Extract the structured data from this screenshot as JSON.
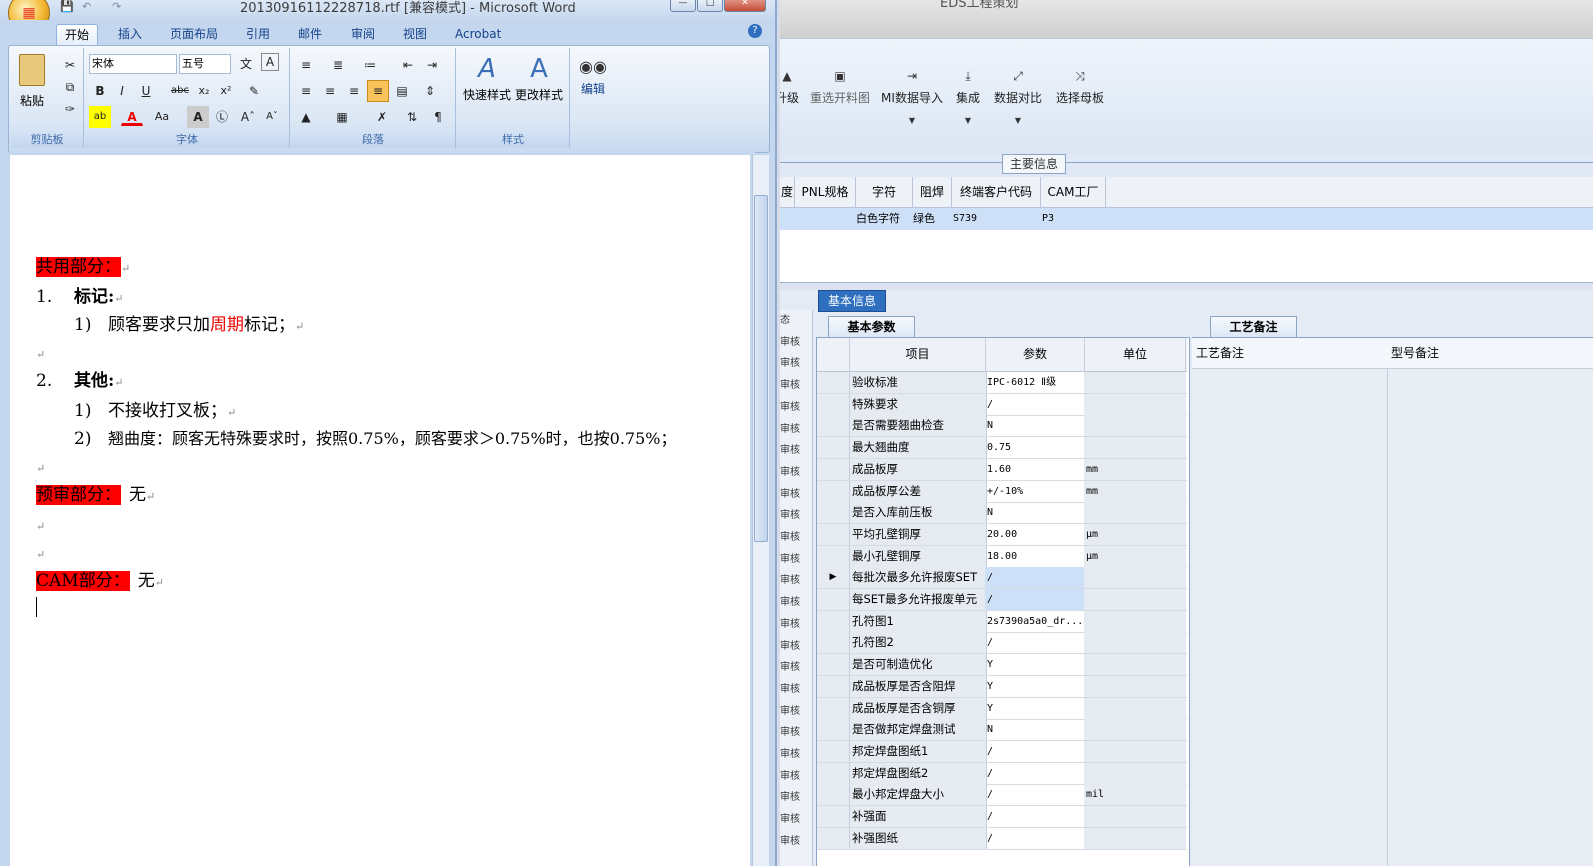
{
  "erp": {
    "title": "EDS工程策划",
    "toolbar": [
      {
        "label": "升级",
        "icon": "upgrade-icon",
        "glyph": "▲",
        "dd": false
      },
      {
        "label": "重选开料图",
        "icon": "image-icon",
        "glyph": "▣",
        "dd": false
      },
      {
        "label": "MI数据导入",
        "icon": "import-icon",
        "glyph": "⇥",
        "dd": true
      },
      {
        "label": "集成",
        "icon": "integrate-icon",
        "glyph": "⤓",
        "dd": true
      },
      {
        "label": "数据对比",
        "icon": "compare-icon",
        "glyph": "⤢",
        "dd": true
      },
      {
        "label": "选择母板",
        "icon": "shuffle-icon",
        "glyph": "⤨",
        "dd": false
      }
    ],
    "main_info_label": "主要信息",
    "grid_columns": [
      "度",
      "PNL规格",
      "字符",
      "阻焊",
      "终端客户代码",
      "CAM工厂"
    ],
    "grid_row": [
      "",
      "",
      "白色字符",
      "绿色",
      "S739",
      "P3"
    ],
    "basic_info_tab": "基本信息",
    "params_tab": "基本参数",
    "param_columns": [
      "项目",
      "参数",
      "单位"
    ],
    "params": [
      {
        "name": "验收标准",
        "value": "IPC-6012 Ⅱ级",
        "unit": ""
      },
      {
        "name": "特殊要求",
        "value": "/",
        "unit": ""
      },
      {
        "name": "是否需要翘曲检查",
        "value": "N",
        "unit": ""
      },
      {
        "name": "最大翘曲度",
        "value": "0.75",
        "unit": ""
      },
      {
        "name": "成品板厚",
        "value": "1.60",
        "unit": "mm"
      },
      {
        "name": "成品板厚公差",
        "value": "+/-10%",
        "unit": "mm"
      },
      {
        "name": "是否入库前压板",
        "value": "N",
        "unit": ""
      },
      {
        "name": "平均孔壁铜厚",
        "value": "20.00",
        "unit": "μm"
      },
      {
        "name": "最小孔壁铜厚",
        "value": "18.00",
        "unit": "μm"
      },
      {
        "name": "每批次最多允许报废SET",
        "value": "/",
        "unit": ""
      },
      {
        "name": "每SET最多允许报废单元",
        "value": "/",
        "unit": ""
      },
      {
        "name": "孔符图1",
        "value": "2s7390a5a0_dr...",
        "unit": ""
      },
      {
        "name": "孔符图2",
        "value": "/",
        "unit": ""
      },
      {
        "name": "是否可制造优化",
        "value": "Y",
        "unit": ""
      },
      {
        "name": "成品板厚是否含阻焊",
        "value": "Y",
        "unit": ""
      },
      {
        "name": "成品板厚是否含铜厚",
        "value": "Y",
        "unit": ""
      },
      {
        "name": "是否做邦定焊盘测试",
        "value": "N",
        "unit": ""
      },
      {
        "name": "邦定焊盘图纸1",
        "value": "/",
        "unit": ""
      },
      {
        "name": "邦定焊盘图纸2",
        "value": "/",
        "unit": ""
      },
      {
        "name": "最小邦定焊盘大小",
        "value": "/",
        "unit": "mil"
      },
      {
        "name": "补强面",
        "value": "/",
        "unit": ""
      },
      {
        "name": "补强图纸",
        "value": "/",
        "unit": ""
      }
    ],
    "left_strip": [
      "态",
      "审核",
      "审核",
      "审核",
      "审核",
      "审核",
      "审核",
      "审核",
      "审核",
      "审核",
      "审核",
      "审核",
      "审核",
      "审核",
      "审核",
      "审核",
      "审核",
      "审核",
      "审核",
      "审核",
      "审核",
      "审核",
      "审核",
      "审核",
      "审核"
    ],
    "craft_tab": "工艺备注",
    "craft_columns": [
      "工艺备注",
      "型号备注"
    ]
  },
  "word": {
    "title": "20130916112228718.rtf [兼容模式] - Microsoft Word",
    "tabs": [
      "开始",
      "插入",
      "页面布局",
      "引用",
      "邮件",
      "审阅",
      "视图",
      "Acrobat"
    ],
    "font_name": "宋体",
    "font_size": "五号",
    "group_labels": [
      "剪贴板",
      "字体",
      "段落",
      "样式"
    ],
    "paste_label": "粘贴",
    "quick_styles": "快速样式",
    "change_styles": "更改样式",
    "edit_label": "编辑",
    "doc": {
      "h1": "共用部分：",
      "item1": "1.",
      "item1_title": "标记:",
      "item1_sub_num": "1)",
      "item1_sub_a": "顾客要求只加",
      "item1_sub_red": "周期",
      "item1_sub_b": "标记；",
      "item2": "2.",
      "item2_title": "其他:",
      "item2_sub1_num": "1)",
      "item2_sub1": "不接收打叉板；",
      "item2_sub2_num": "2)",
      "item2_sub2": "翘曲度：顾客无特殊要求时，按照0.75%，顾客要求＞0.75%时，也按0.75%；",
      "h2": "预审部分：",
      "h2_val": "无",
      "h3": "CAM部分：",
      "h3_val": "无"
    }
  }
}
